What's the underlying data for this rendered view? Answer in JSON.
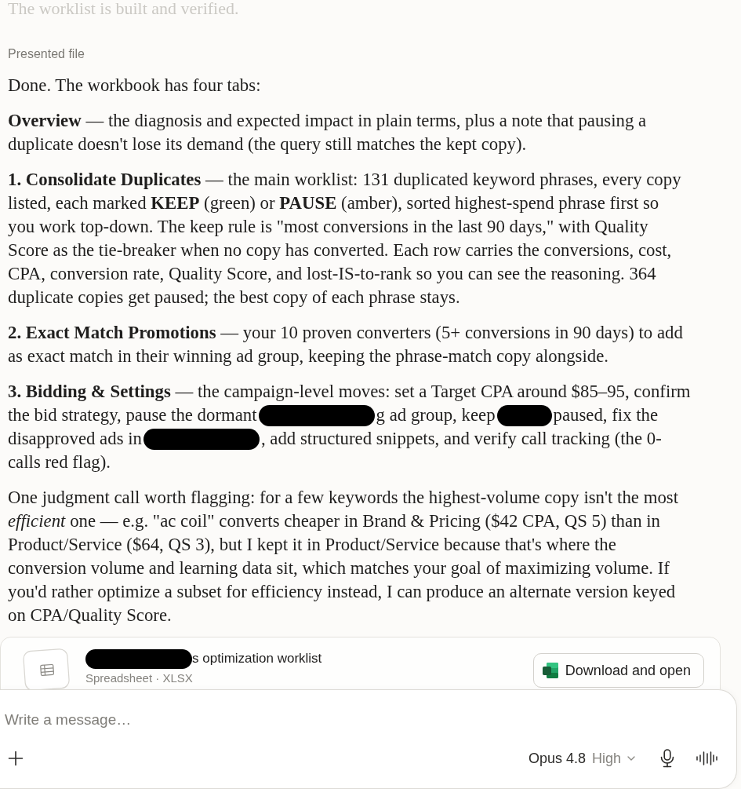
{
  "previous_message": {
    "text": "The worklist is built and verified."
  },
  "file_section": {
    "label": "Presented file"
  },
  "response": {
    "paragraphs": [
      {
        "kind": "text",
        "text": "Done. The workbook has four tabs:"
      },
      {
        "kind": "text",
        "text": "**Overview** — the diagnosis and expected impact in plain terms, plus a note that pausing a duplicate doesn't lose its demand (the query still matches the kept copy)."
      },
      {
        "kind": "text",
        "text": "**1. Consolidate Duplicates** — the main worklist: 131 duplicated keyword phrases, every copy listed, each marked **KEEP** (green) or **PAUSE** (amber), sorted highest-spend phrase first so you work top-down. The keep rule is \"most conversions in the last 90 days,\" with Quality Score as the tie-breaker when no copy has converted. Each row carries the conversions, cost, CPA, conversion rate, Quality Score, and lost-IS-to-rank so you can see the reasoning. 364 duplicate copies get paused; the best copy of each phrase stays."
      },
      {
        "kind": "text",
        "text": "**2. Exact Match Promotions** — your 10 proven converters (5+ conversions in 90 days) to add as exact match in their winning ad group, keeping the phrase-match copy alongside."
      },
      {
        "kind": "lines",
        "lines": [
          [
            {
              "kind": "text",
              "text": "**3. Bidding & Settings** — the campaign-level moves: set a Target CPA around $85–95, confirm"
            }
          ],
          [
            {
              "kind": "text",
              "text": "the bid strategy, pause the dormant"
            },
            {
              "kind": "redaction",
              "wide": true
            },
            {
              "kind": "text",
              "text": "g ad group, keep"
            },
            {
              "kind": "redaction",
              "wide": false
            },
            {
              "kind": "text",
              "text": "paused, fix the"
            }
          ],
          [
            {
              "kind": "text",
              "text": "disapproved ads in"
            },
            {
              "kind": "redaction",
              "wide": true
            },
            {
              "kind": "text",
              "text": ", add structured snippets, and verify call tracking (the 0-"
            }
          ],
          [
            {
              "kind": "text",
              "text": "calls red flag)."
            }
          ]
        ]
      },
      {
        "kind": "text",
        "text": "One judgment call worth flagging: for a few keywords the highest-volume copy isn't the most *efficient* one — e.g. \"ac coil\" converts cheaper in Brand & Pricing ($42 CPA, QS 5) than in Product/Service ($64, QS 3), but I kept it in Product/Service because that's where the conversion volume and learning data sit, which matches your goal of maximizing volume. If you'd rather optimize a subset for efficiency instead, I can produce an alternate version keyed on CPA/Quality Score."
      }
    ]
  },
  "file_card": {
    "title_parts": [
      {
        "kind": "redaction",
        "wide": true
      },
      {
        "kind": "text",
        "text": "s optimization worklist"
      }
    ],
    "subtitle": "Spreadsheet · XLSX",
    "button": "Download and open"
  },
  "composer": {
    "placeholder": "Write a message…",
    "model": "Opus 4.8",
    "effort": "High"
  }
}
